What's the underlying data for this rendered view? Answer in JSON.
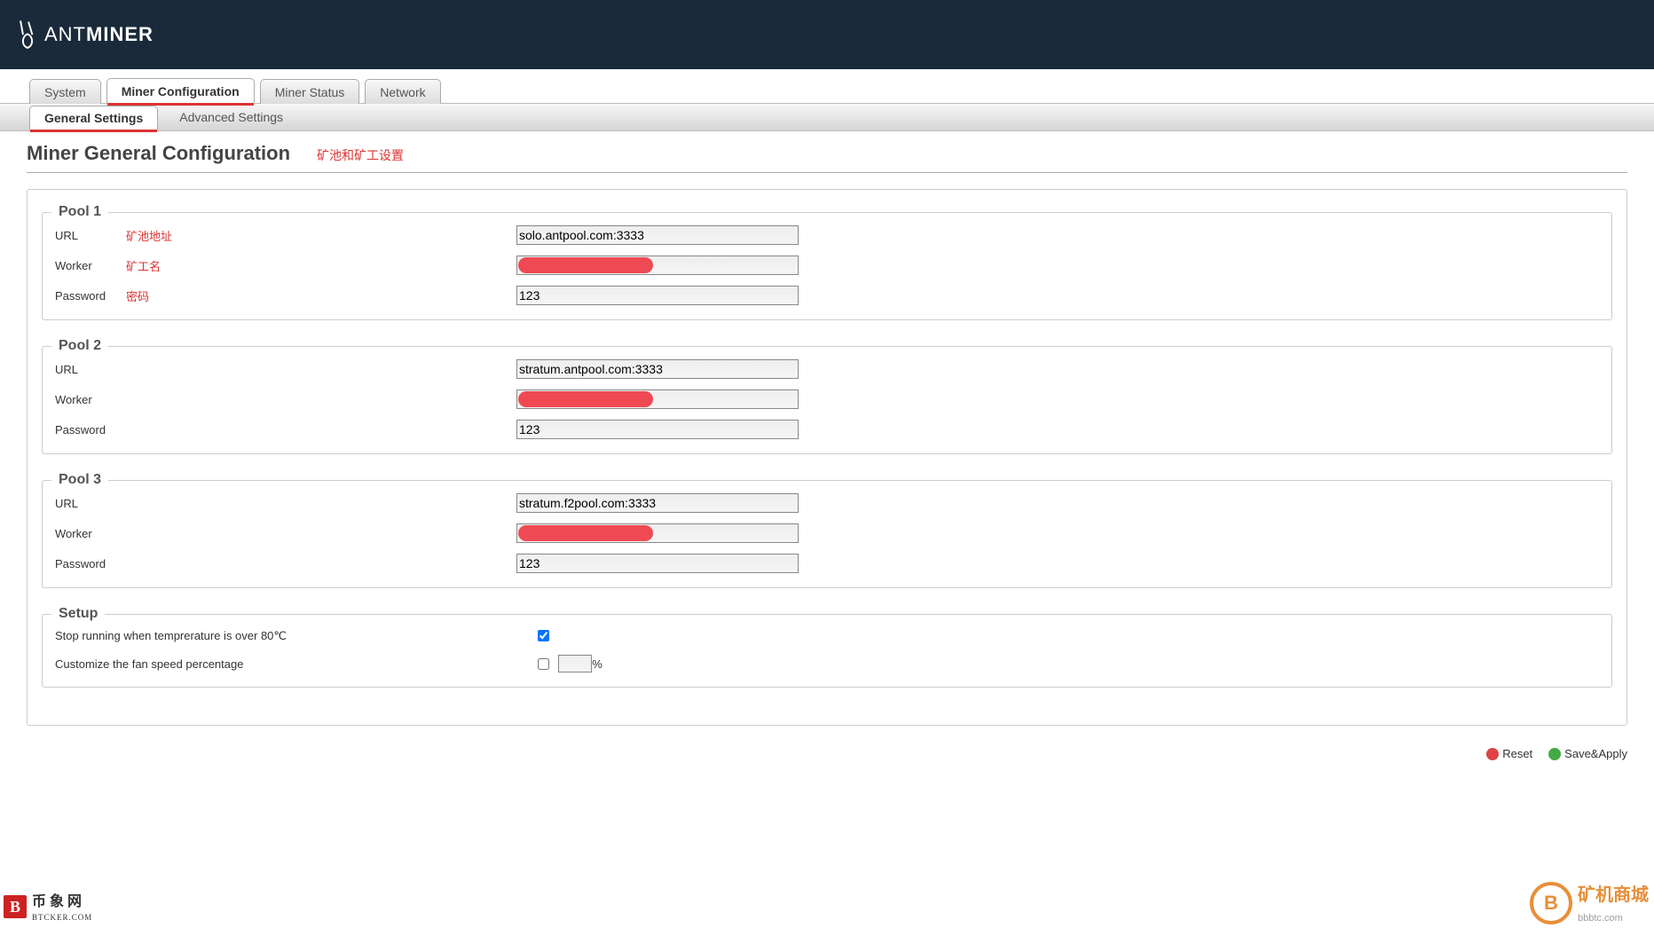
{
  "brand": {
    "name_a": "ANT",
    "name_b": "MINER"
  },
  "tabs": {
    "primary": [
      {
        "label": "System"
      },
      {
        "label": "Miner Configuration"
      },
      {
        "label": "Miner Status"
      },
      {
        "label": "Network"
      }
    ],
    "secondary": [
      {
        "label": "General Settings"
      },
      {
        "label": "Advanced Settings"
      }
    ]
  },
  "heading": "Miner General Configuration",
  "heading_note": "矿池和矿工设置",
  "annotations": {
    "url": "矿池地址",
    "worker": "矿工名",
    "password": "密码"
  },
  "labels": {
    "url": "URL",
    "worker": "Worker",
    "password": "Password"
  },
  "pools": [
    {
      "legend": "Pool 1",
      "url": "solo.antpool.com:3333",
      "worker": "",
      "password": "123",
      "show_annotations": true
    },
    {
      "legend": "Pool 2",
      "url": "stratum.antpool.com:3333",
      "worker": "",
      "password": "123",
      "show_annotations": false
    },
    {
      "legend": "Pool 3",
      "url": "stratum.f2pool.com:3333",
      "worker": "",
      "password": "123",
      "show_annotations": false
    }
  ],
  "setup": {
    "legend": "Setup",
    "stoptemp_label": "Stop running when temprerature is over 80℃",
    "stoptemp_checked": true,
    "fanspeed_label": "Customize the fan speed percentage",
    "fanspeed_checked": false,
    "fanspeed_value": "",
    "fanspeed_suffix": "%"
  },
  "footer": {
    "reset": "Reset",
    "save": "Save&Apply"
  },
  "watermarks": {
    "left_line1": "币 象 网",
    "left_line2": "BTCKER.COM",
    "right_text": "矿机商城",
    "right_sub": "bbbtc.com"
  }
}
